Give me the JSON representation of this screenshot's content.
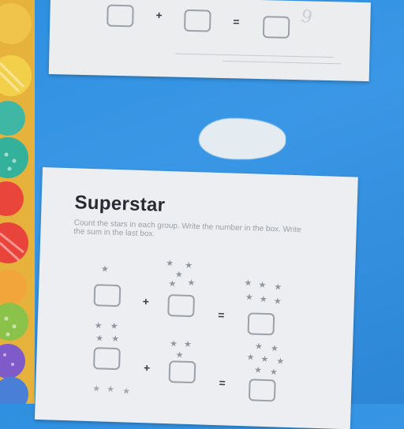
{
  "worksheet_top": {
    "plus": "+",
    "equals": "=",
    "answer_mark": "9"
  },
  "worksheet_main": {
    "title": "Superstar",
    "instructions": "Count the stars in each group. Write the number in the box. Write the sum in the last box.",
    "row1": {
      "plus": "+",
      "equals": "="
    },
    "row2": {
      "plus": "+",
      "equals": "="
    },
    "star_glyph": "★"
  },
  "colors": {
    "board_blue": "#2f8fe0",
    "paper": "#eceef1",
    "title_text": "#2a2a33"
  }
}
